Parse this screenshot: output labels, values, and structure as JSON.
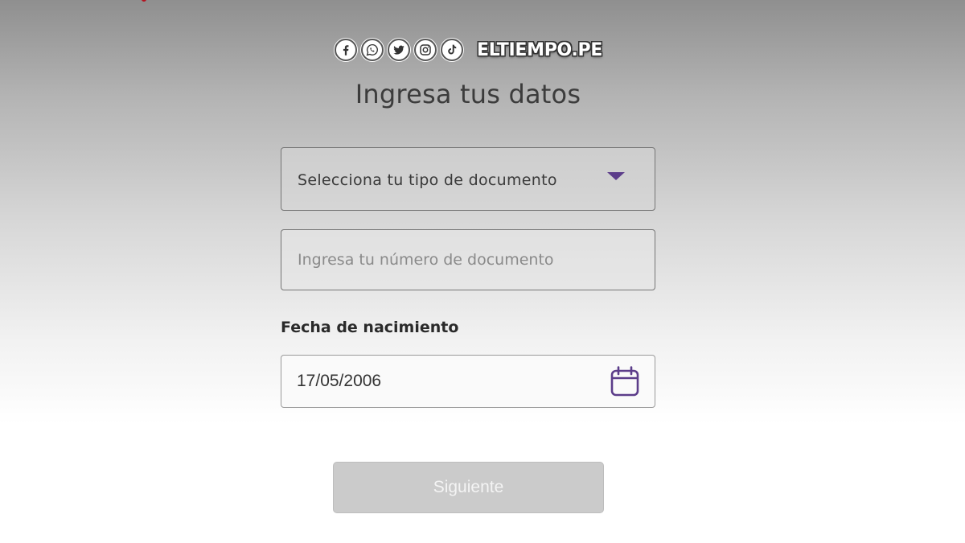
{
  "brand": {
    "name": "ELTIEMPO.PE",
    "social_icons": [
      "facebook-icon",
      "whatsapp-icon",
      "twitter-icon",
      "instagram-icon",
      "tiktok-icon"
    ]
  },
  "page": {
    "title": "Ingresa tus datos"
  },
  "form": {
    "document_type": {
      "value": "Selecciona tu tipo de documento"
    },
    "document_number": {
      "placeholder": "Ingresa tu número de documento",
      "value": ""
    },
    "birth_date": {
      "label": "Fecha de nacimiento",
      "value": "17/05/2006"
    },
    "next_button": {
      "label": "Siguiente",
      "enabled": false
    }
  },
  "colors": {
    "accent": "#5c3d8a",
    "disabled_button": "#cbcbcb",
    "brand_mark": "#b3121f"
  }
}
